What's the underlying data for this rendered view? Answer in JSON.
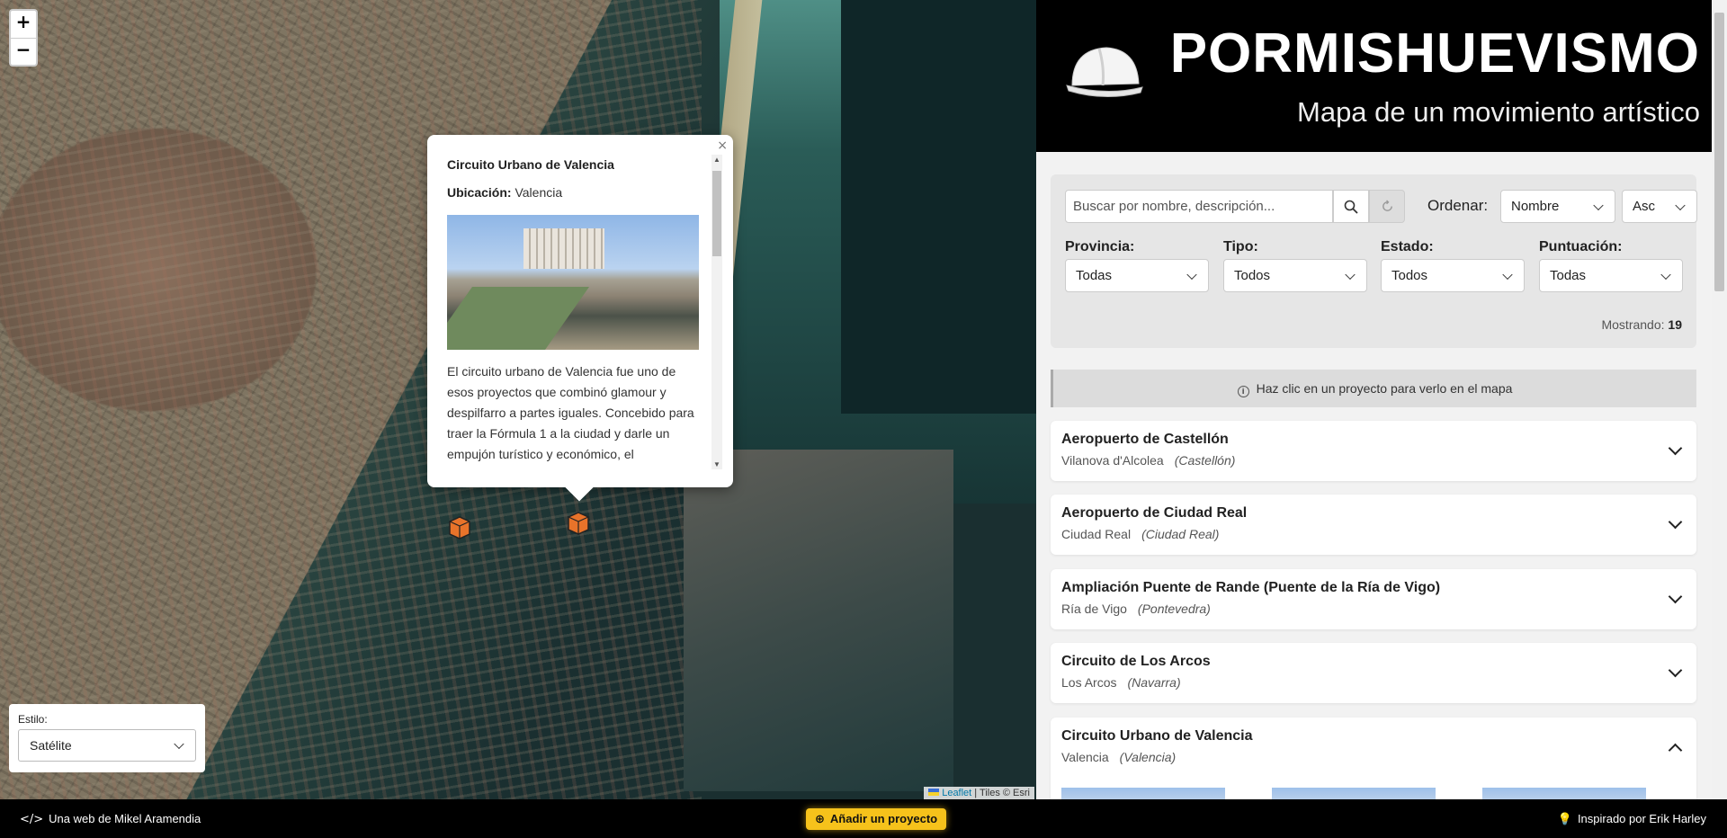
{
  "map": {
    "zoom_in": "+",
    "zoom_out": "−",
    "attribution_link": "Leaflet",
    "attribution_text": "| Tiles © Esri",
    "style_label": "Estilo:",
    "style_value": "Satélite"
  },
  "popup": {
    "title": "Circuito Urbano de Valencia",
    "location_label": "Ubicación:",
    "location_value": "Valencia",
    "description": "El circuito urbano de Valencia fue uno de esos proyectos que combinó glamour y despilfarro a partes iguales. Concebido para traer la Fórmula 1 a la ciudad y darle un empujón turístico y económico, el",
    "close": "×"
  },
  "header": {
    "brand": "PORMISHUEVISMO",
    "tagline": "Mapa de un movimiento artístico",
    "helmet_icon": "helmet-icon"
  },
  "filters": {
    "search_placeholder": "Buscar por nombre, descripción...",
    "order_label": "Ordenar:",
    "order_by": "Nombre",
    "order_dir": "Asc",
    "provincia_label": "Provincia:",
    "provincia_value": "Todas",
    "tipo_label": "Tipo:",
    "tipo_value": "Todos",
    "estado_label": "Estado:",
    "estado_value": "Todos",
    "puntuacion_label": "Puntuación:",
    "puntuacion_value": "Todas",
    "showing_label": "Mostrando:",
    "showing_count": "19"
  },
  "hint": "Haz clic en un proyecto para verlo en el mapa",
  "projects": [
    {
      "name": "Aeropuerto de Castellón",
      "place": "Vilanova d'Alcolea",
      "province": "(Castellón)"
    },
    {
      "name": "Aeropuerto de Ciudad Real",
      "place": "Ciudad Real",
      "province": "(Ciudad Real)"
    },
    {
      "name": "Ampliación Puente de Rande (Puente de la Ría de Vigo)",
      "place": "Ría de Vigo",
      "province": "(Pontevedra)"
    },
    {
      "name": "Circuito de Los Arcos",
      "place": "Los Arcos",
      "province": "(Navarra)"
    },
    {
      "name": "Circuito Urbano de Valencia",
      "place": "Valencia",
      "province": "(Valencia)"
    }
  ],
  "footer": {
    "left": "Una web de Mikel Aramendia",
    "add": "Añadir un proyecto",
    "right": "Inspirado por Erik Harley"
  },
  "colors": {
    "accent": "#f6c21b",
    "marker": "#e8732a"
  }
}
